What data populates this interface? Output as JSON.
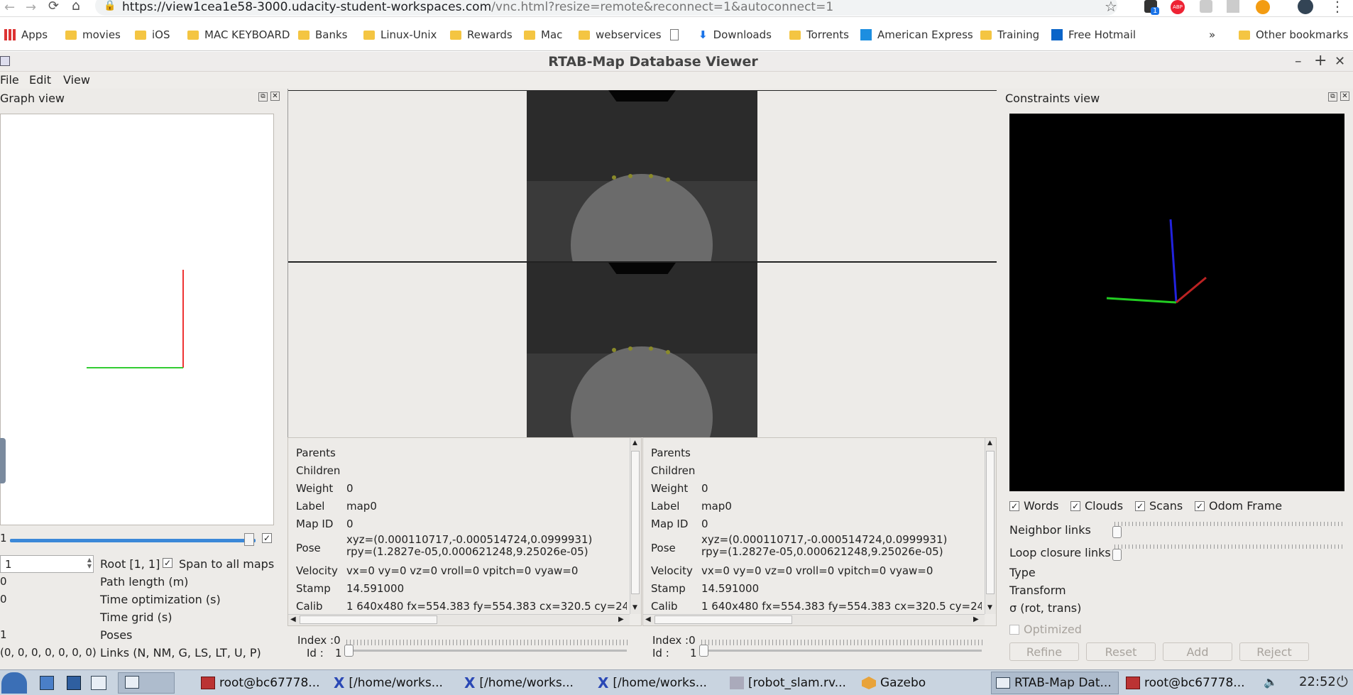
{
  "browser": {
    "url_host": "https://view1cea1e58-3000.udacity-student-workspaces.com",
    "url_path": "/vnc.html?resize=remote&reconnect=1&autoconnect=1",
    "ext_badge": "1",
    "abp": "ABP"
  },
  "bookmarks": {
    "apps": "Apps",
    "items": [
      "movies",
      "iOS",
      "MAC KEYBOARD",
      "Banks",
      "Linux-Unix",
      "Rewards",
      "Mac",
      "webservices",
      "",
      "Downloads",
      "Torrents",
      "American Express",
      "Training",
      "Free Hotmail"
    ],
    "overflow": "»",
    "other": "Other bookmarks"
  },
  "window": {
    "title": "RTAB-Map Database Viewer",
    "min": "–",
    "max": "+",
    "close": "✕"
  },
  "menu": {
    "file": "File",
    "edit": "Edit",
    "view": "View"
  },
  "graph": {
    "title": "Graph view",
    "slider_left": "1",
    "spin_value": "1",
    "root": "Root [1, 1]",
    "span_label": "Span to all maps",
    "rows": [
      {
        "value": "0",
        "label": "Path length (m)"
      },
      {
        "value": "0",
        "label": "Time optimization (s)"
      },
      {
        "value": "",
        "label": "Time grid (s)"
      },
      {
        "value": "1",
        "label": "Poses"
      },
      {
        "value": "(0, 0, 0, 0, 0, 0, 0)",
        "label": "Links (N, NM, G, LS, LT, U, P)"
      }
    ]
  },
  "info": {
    "keys": [
      "Parents",
      "Children",
      "Weight",
      "Label",
      "Map ID",
      "Pose",
      "Velocity",
      "Stamp",
      "Calib"
    ],
    "left": {
      "weight": "0",
      "label": "map0",
      "mapid": "0",
      "pose1": "xyz=(0.000110717,-0.000514724,0.0999931)",
      "pose2": "rpy=(1.2827e-05,0.000621248,9.25026e-05)",
      "velocity": "vx=0 vy=0 vz=0 vroll=0 vpitch=0 vyaw=0",
      "stamp": "14.591000",
      "calib": "1 640x480 fx=554.383 fy=554.383 cx=320.5 cy=24"
    },
    "right": {
      "weight": "0",
      "label": "map0",
      "mapid": "0",
      "pose1": "xyz=(0.000110717,-0.000514724,0.0999931)",
      "pose2": "rpy=(1.2827e-05,0.000621248,9.25026e-05)",
      "velocity": "vx=0 vy=0 vz=0 vroll=0 vpitch=0 vyaw=0",
      "stamp": "14.591000",
      "calib": "1 640x480 fx=554.383 fy=554.383 cx=320.5 cy=24"
    },
    "index_left": "Index :0",
    "id_left": "Id :",
    "id_left_val": "1",
    "index_right": "Index :0",
    "id_right": "Id :",
    "id_right_val": "1"
  },
  "constraints": {
    "title": "Constraints view",
    "checks": [
      "Words",
      "Clouds",
      "Scans",
      "Odom Frame"
    ],
    "neighbor": "Neighbor links",
    "loop": "Loop closure links",
    "type": "Type",
    "transform": "Transform",
    "sigma": "σ (rot, trans)",
    "optimized": "Optimized",
    "buttons": [
      "Refine",
      "Reset",
      "Add",
      "Reject"
    ]
  },
  "taskbar": {
    "tasks": [
      "root@bc67778...",
      "[/home/works...",
      "[/home/works...",
      "[/home/works...",
      "[robot_slam.rv...",
      "Gazebo",
      "RTAB-Map Dat...",
      "root@bc67778..."
    ],
    "clock": "22:52"
  }
}
